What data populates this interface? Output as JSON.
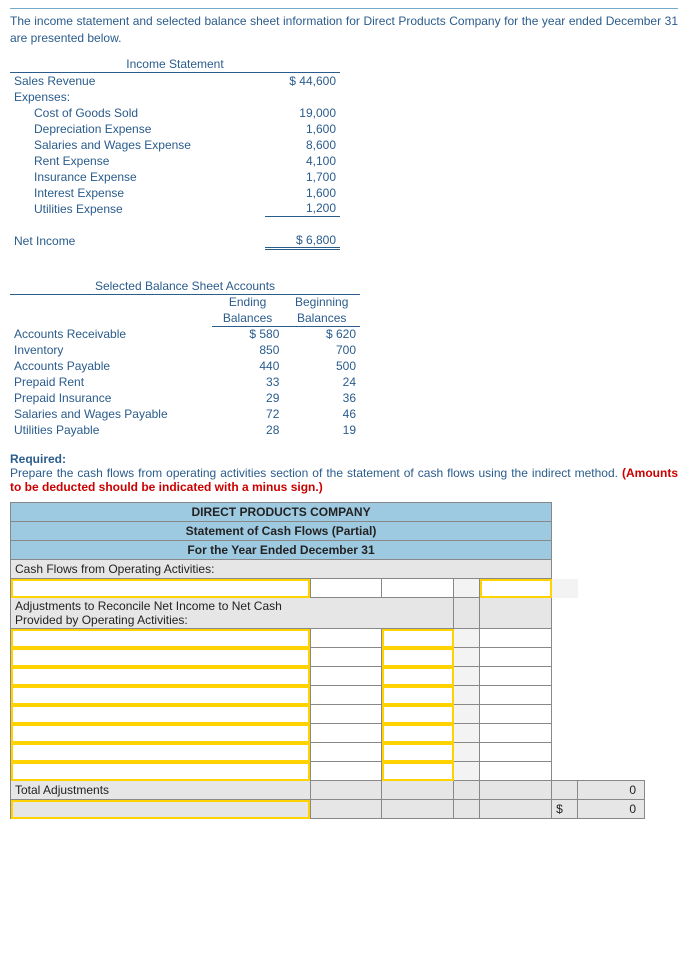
{
  "intro": "The income statement and selected balance sheet information for Direct Products Company for the year ended December 31 are presented below.",
  "income": {
    "title": "Income Statement",
    "sales_label": "Sales Revenue",
    "sales_value": "$ 44,600",
    "expenses_label": "Expenses:",
    "cogs_label": "Cost of Goods Sold",
    "cogs_value": "19,000",
    "dep_label": "Depreciation Expense",
    "dep_value": "1,600",
    "sw_label": "Salaries and Wages Expense",
    "sw_value": "8,600",
    "rent_label": "Rent Expense",
    "rent_value": "4,100",
    "ins_label": "Insurance Expense",
    "ins_value": "1,700",
    "int_label": "Interest Expense",
    "int_value": "1,600",
    "util_label": "Utilities Expense",
    "util_value": "1,200",
    "ni_label": "Net Income",
    "ni_value": "$  6,800"
  },
  "balance": {
    "title": "Selected Balance Sheet Accounts",
    "col_end_1": "Ending",
    "col_end_2": "Balances",
    "col_beg_1": "Beginning",
    "col_beg_2": "Balances",
    "ar_label": "Accounts Receivable",
    "ar_end": "$   580",
    "ar_beg": "$   620",
    "inv_label": "Inventory",
    "inv_end": "850",
    "inv_beg": "700",
    "ap_label": "Accounts Payable",
    "ap_end": "440",
    "ap_beg": "500",
    "pr_label": "Prepaid Rent",
    "pr_end": "33",
    "pr_beg": "24",
    "pi_label": "Prepaid Insurance",
    "pi_end": "29",
    "pi_beg": "36",
    "swp_label": "Salaries and Wages Payable",
    "swp_end": "72",
    "swp_beg": "46",
    "up_label": "Utilities Payable",
    "up_end": "28",
    "up_beg": "19"
  },
  "req": {
    "hdr": "Required:",
    "body": "Prepare the cash flows from operating activities section of the statement of cash flows using the indirect method. ",
    "red": "(Amounts to be deducted should be indicated with a minus sign.)"
  },
  "wk": {
    "t1": "DIRECT PRODUCTS COMPANY",
    "t2": "Statement of Cash Flows (Partial)",
    "t3": "For the Year Ended December 31",
    "row_cfo": "Cash Flows from Operating Activities:",
    "row_adj1": "Adjustments to Reconcile Net Income to Net Cash",
    "row_adj2": "Provided by Operating Activities:",
    "row_total": "Total Adjustments",
    "dollars": "$",
    "zero": "0"
  }
}
